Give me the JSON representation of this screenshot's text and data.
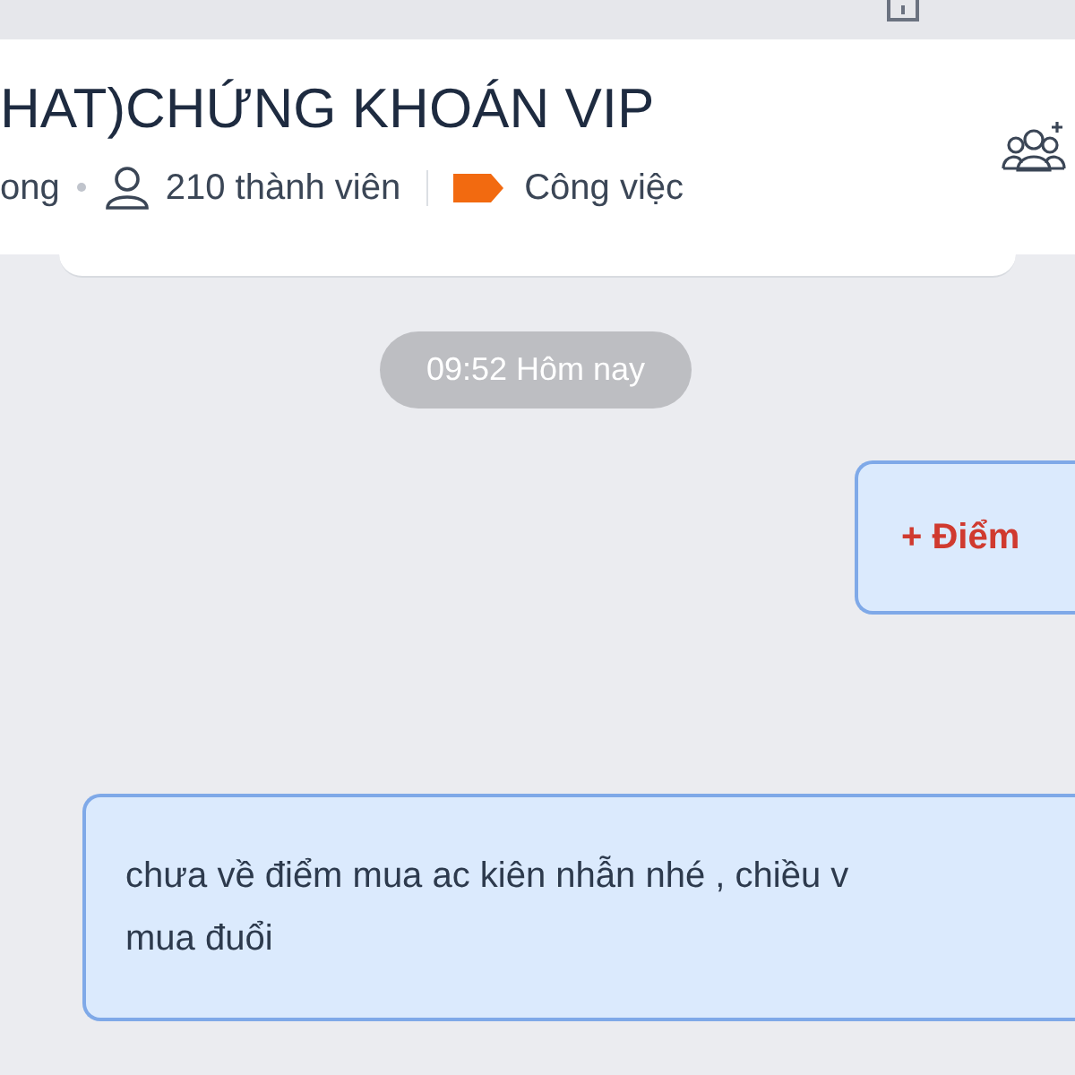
{
  "header": {
    "title": "HAT)CHỨNG KHOÁN VIP",
    "status": "ong",
    "members": "210 thành viên",
    "tag": {
      "label": "Công việc",
      "color": "#f26a10"
    }
  },
  "timestamp": "09:52 Hôm nay",
  "messages": [
    {
      "kind": "highlight",
      "lines": [
        "+ Điểm"
      ]
    },
    {
      "kind": "plain",
      "lines": [
        "chưa về điểm mua ac kiên nhẫn nhé , chiều v",
        "mua đuổi"
      ]
    }
  ]
}
